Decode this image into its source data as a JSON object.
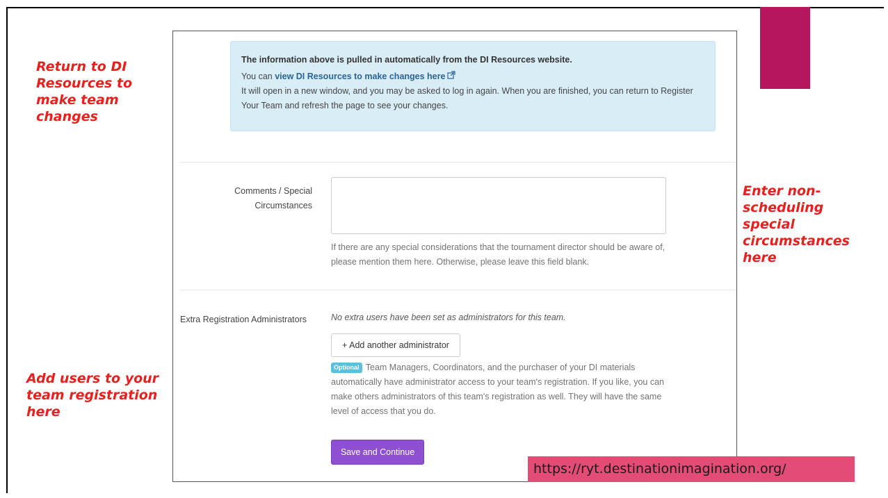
{
  "callouts": {
    "left_top": [
      "Return to DI",
      "Resources to",
      "make team",
      "changes"
    ],
    "right": [
      "Enter non-",
      "scheduling",
      "special",
      "circumstances",
      "here"
    ],
    "left_bottom": [
      "Add users to your",
      "team registration",
      "here"
    ]
  },
  "info_box": {
    "heading": "The information above is pulled in automatically from the DI Resources website.",
    "line2_prefix": "You can ",
    "line2_link": "view DI Resources to make changes here",
    "line3": "It will open in a new window, and you may be asked to log in again. When you are finished, you can return to Register Your Team and refresh the page to see your changes."
  },
  "comments": {
    "label_line1": "Comments / Special",
    "label_line2": "Circumstances",
    "value": "",
    "help": "If there are any special considerations that the tournament director should be aware of, please mention them here. Otherwise, please leave this field blank."
  },
  "admins": {
    "label": "Extra Registration Administrators",
    "empty_text": "No extra users have been set as administrators for this team.",
    "add_button": "+ Add another administrator",
    "badge": "Optional",
    "help": "Team Managers, Coordinators, and the purchaser of your DI materials automatically have administrator access to your team's registration. If you like, you can make others administrators of this team's registration as well. They will have the same level of access that you do."
  },
  "save_button": "Save and Continue",
  "url_banner": "https://ryt.destinationimagination.org/",
  "colors": {
    "accent_bar": "#b5165e",
    "callout_text": "#e8201e",
    "save_button": "#8f4fd1",
    "url_banner": "#e34d75",
    "info_box_bg": "#d9edf7"
  }
}
